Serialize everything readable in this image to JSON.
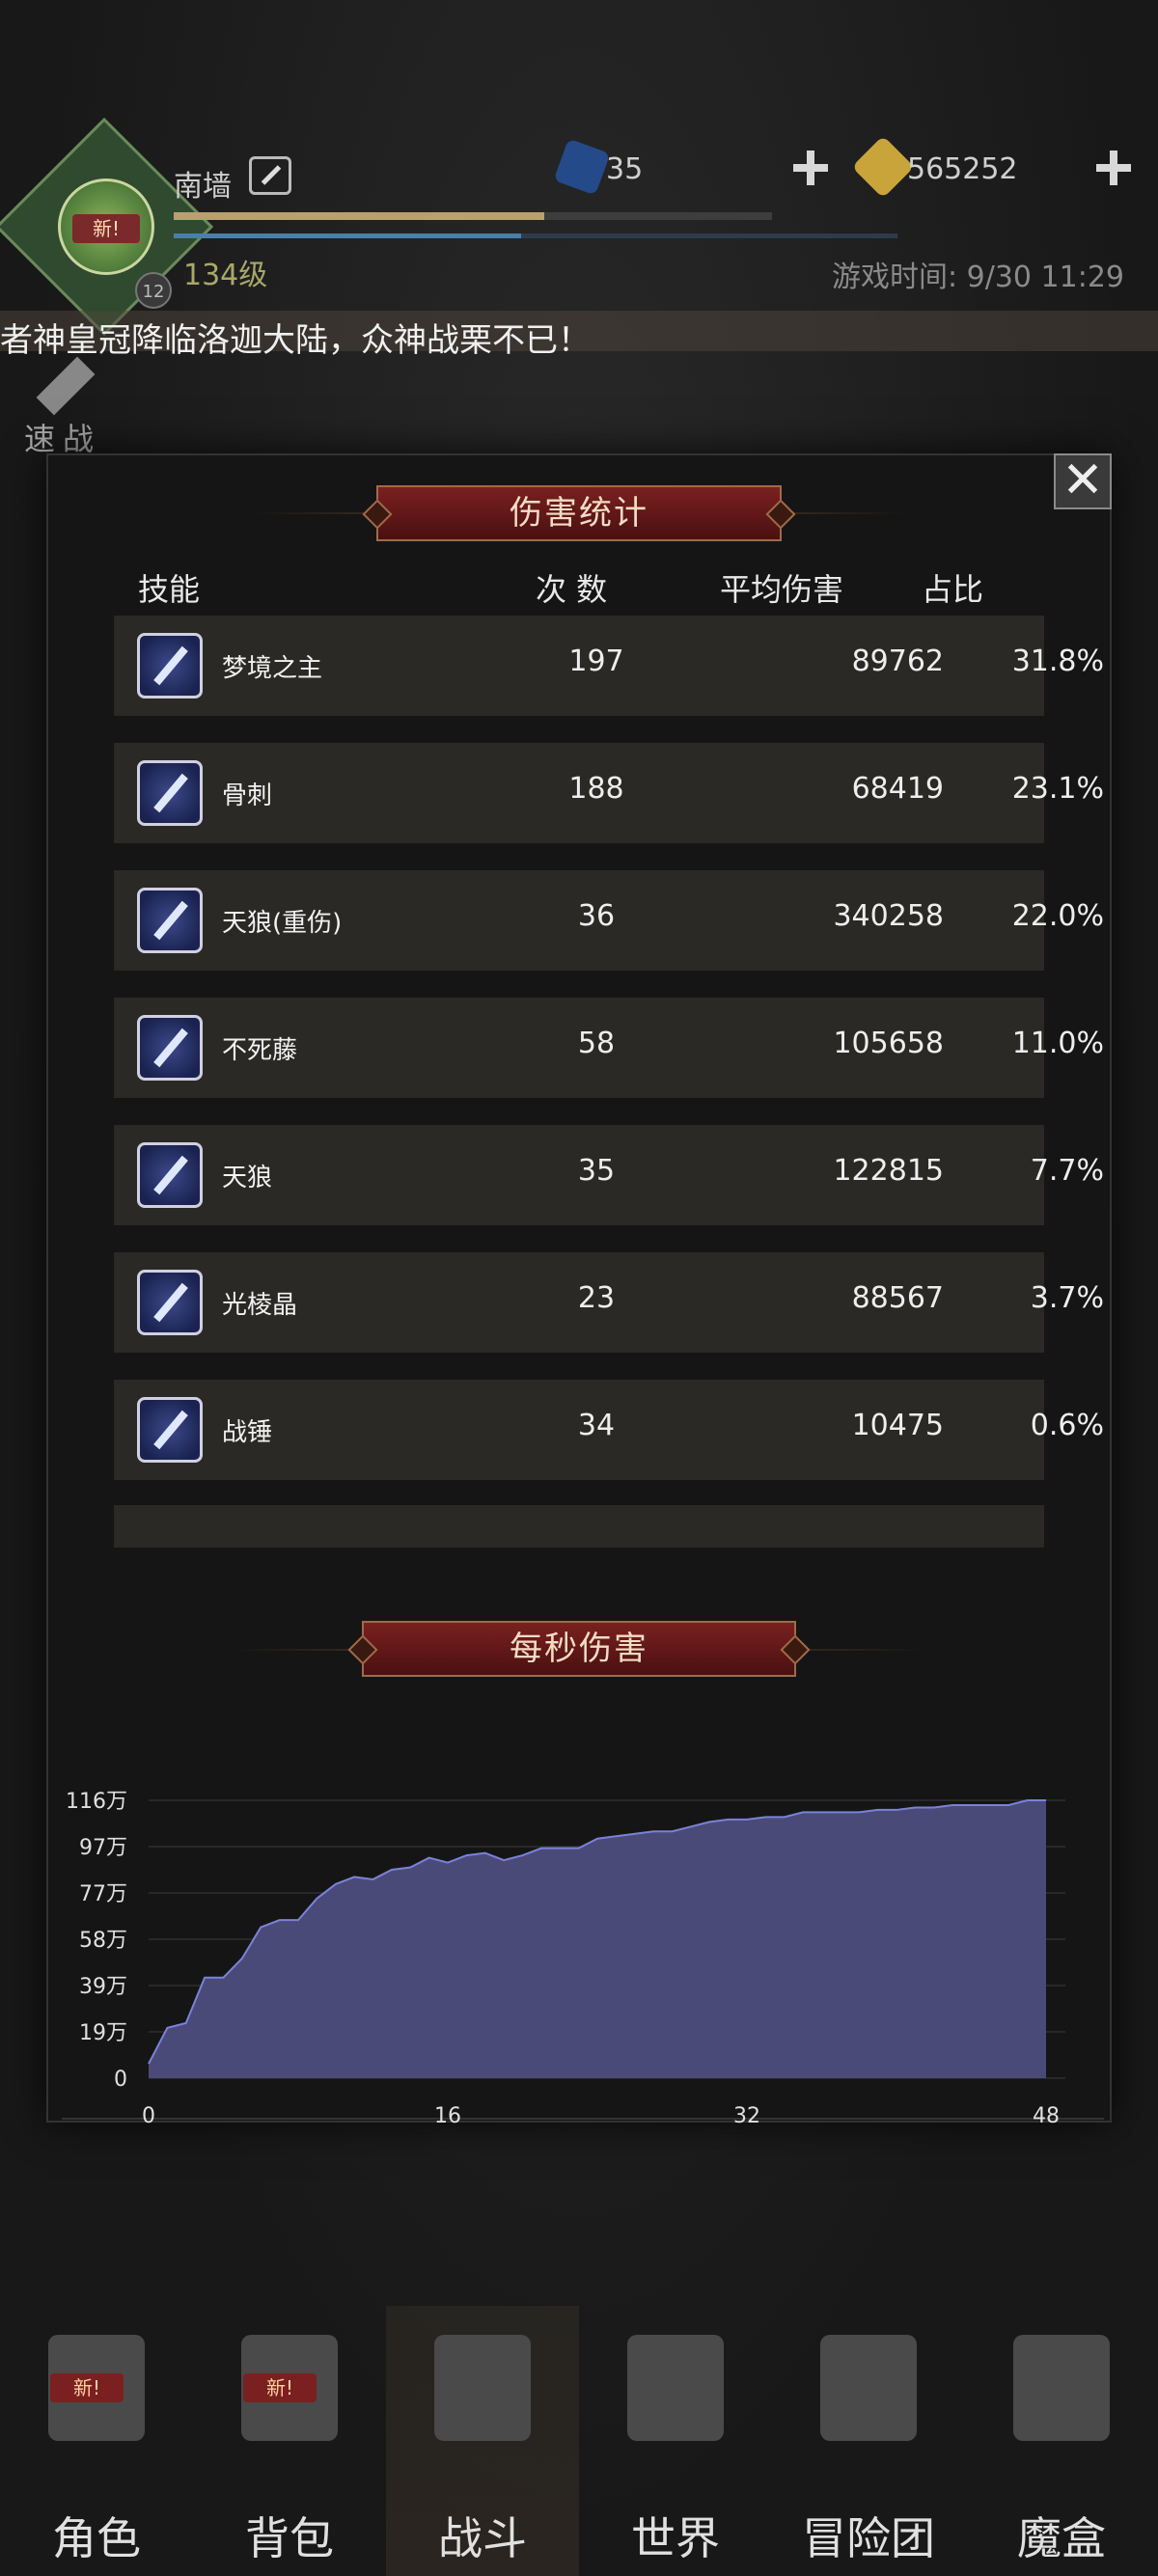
{
  "header": {
    "player_name": "南墙",
    "player_level": "134级",
    "avatar_badge": "新!",
    "avatar_small_level": "12",
    "gems": "35",
    "gold": "565252",
    "game_time": "游戏时间: 9/30 11:29",
    "announcement": "者神皇冠降临洛迦大陆，众神战栗不已！",
    "quick_battle_label": "速战",
    "xp_fraction": 0.62,
    "mp_fraction": 0.48
  },
  "modal": {
    "damage_title": "伤害统计",
    "close_symbol": "✕",
    "columns": {
      "skill": "技能",
      "count": "次 数",
      "avg": "平均伤害",
      "pct": "占比"
    },
    "rows": [
      {
        "name": "梦境之主",
        "count": "197",
        "avg": "89762",
        "pct": "31.8%",
        "icon": "sword-icon"
      },
      {
        "name": "骨刺",
        "count": "188",
        "avg": "68419",
        "pct": "23.1%",
        "icon": "sword-icon"
      },
      {
        "name": "天狼(重伤)",
        "count": "36",
        "avg": "340258",
        "pct": "22.0%",
        "icon": "sword-icon"
      },
      {
        "name": "不死藤",
        "count": "58",
        "avg": "105658",
        "pct": "11.0%",
        "icon": "vine-icon"
      },
      {
        "name": "天狼",
        "count": "35",
        "avg": "122815",
        "pct": "7.7%",
        "icon": "fang-icon"
      },
      {
        "name": "光棱晶",
        "count": "23",
        "avg": "88567",
        "pct": "3.7%",
        "icon": "crystal-icon"
      },
      {
        "name": "战锤",
        "count": "34",
        "avg": "10475",
        "pct": "0.6%",
        "icon": "sword-icon"
      }
    ],
    "dps_title": "每秒伤害"
  },
  "chart_data": {
    "type": "area",
    "title": "每秒伤害",
    "y_tick_labels": [
      "0",
      "19万",
      "39万",
      "58万",
      "77万",
      "97万",
      "116万"
    ],
    "x_tick_labels": [
      "0",
      "16",
      "32",
      "48"
    ],
    "xlim": [
      0,
      48
    ],
    "ylim": [
      0,
      116
    ],
    "y_unit": "万",
    "x": [
      0,
      1,
      2,
      3,
      4,
      5,
      6,
      7,
      8,
      9,
      10,
      11,
      12,
      13,
      14,
      15,
      16,
      17,
      18,
      19,
      20,
      21,
      22,
      23,
      24,
      25,
      26,
      27,
      28,
      29,
      30,
      31,
      32,
      33,
      34,
      35,
      36,
      37,
      38,
      39,
      40,
      41,
      42,
      43,
      44,
      45,
      46,
      47,
      48
    ],
    "y": [
      6,
      21,
      23,
      42,
      42,
      50,
      63,
      66,
      66,
      75,
      81,
      84,
      83,
      87,
      88,
      92,
      90,
      93,
      94,
      91,
      93,
      96,
      96,
      96,
      100,
      101,
      102,
      103,
      103,
      105,
      107,
      108,
      108,
      109,
      109,
      111,
      111,
      111,
      111,
      112,
      112,
      113,
      113,
      114,
      114,
      114,
      114,
      116,
      116
    ],
    "fill_color": "#4a4a78",
    "line_color": "#7a82d8",
    "grid": true
  },
  "nav": {
    "items": [
      {
        "label": "角色",
        "badge": "新!",
        "icon": "helmet-icon"
      },
      {
        "label": "背包",
        "badge": "新!",
        "icon": "backpack-icon"
      },
      {
        "label": "战斗",
        "badge": "",
        "icon": "shield-sword-icon"
      },
      {
        "label": "世界",
        "badge": "",
        "icon": "map-icon"
      },
      {
        "label": "冒险团",
        "badge": "",
        "icon": "castle-icon"
      },
      {
        "label": "魔盒",
        "badge": "",
        "icon": "cube-icon"
      }
    ]
  }
}
